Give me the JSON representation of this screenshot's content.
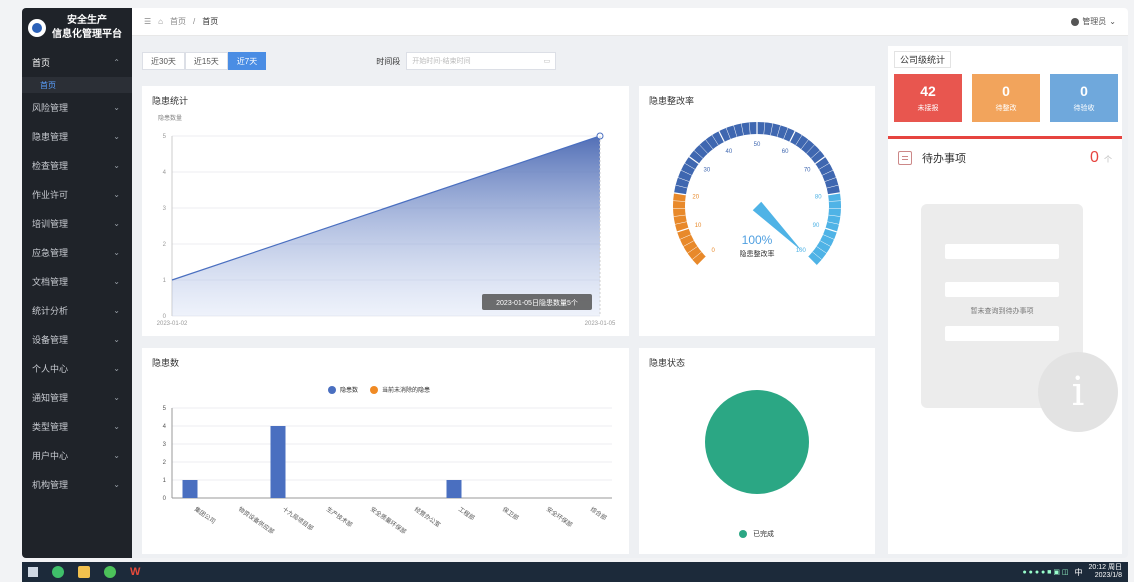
{
  "brand": {
    "line1": "安全生产",
    "line2": "信息化管理平台"
  },
  "sidebar": {
    "items": [
      {
        "label": "首页",
        "open": true
      },
      {
        "label": "风险管理"
      },
      {
        "label": "隐患管理"
      },
      {
        "label": "检查管理"
      },
      {
        "label": "作业许可"
      },
      {
        "label": "培训管理"
      },
      {
        "label": "应急管理"
      },
      {
        "label": "文档管理"
      },
      {
        "label": "统计分析"
      },
      {
        "label": "设备管理"
      },
      {
        "label": "个人中心"
      },
      {
        "label": "通知管理"
      },
      {
        "label": "类型管理"
      },
      {
        "label": "用户中心"
      },
      {
        "label": "机构管理"
      }
    ],
    "sub_item": "首页"
  },
  "topbar": {
    "menu_icon": "☰",
    "home_icon": "home-icon",
    "crumb1": "首页",
    "crumb2": "首页",
    "user": "管理员"
  },
  "toolbar": {
    "ranges": [
      "近30天",
      "近15天",
      "近7天"
    ],
    "active_range": "近7天",
    "date_label": "时间段",
    "date_placeholder": "开始时间-结束时间"
  },
  "panels": {
    "hazard_stats": "隐患统计",
    "rectify_rate": "隐患整改率",
    "hazard_count": "隐患数",
    "hazard_status": "隐患状态",
    "company_stats": "公司级统计"
  },
  "summary": {
    "found": {
      "value": "42",
      "label": "未接报",
      "color": "#e8564f"
    },
    "pending": {
      "value": "0",
      "label": "待整改",
      "color": "#f2a45c"
    },
    "review": {
      "value": "0",
      "label": "待验收",
      "color": "#6fa8dc"
    }
  },
  "todo": {
    "title": "待办事项",
    "count": "0",
    "unit": "个",
    "empty_text": "暂未查询到待办事项"
  },
  "taskbar": {
    "time": "20:12 周日",
    "date": "2023/1/8"
  },
  "chart_data": [
    {
      "type": "area",
      "title": "隐患统计",
      "ylabel": "隐患数量",
      "x": [
        "2023-01-02",
        "2023-01-05"
      ],
      "values": [
        1,
        5
      ],
      "xlim": [
        "2023-01-02",
        "2023-01-05"
      ],
      "ylim": [
        0,
        5
      ],
      "yticks": [
        0,
        1,
        2,
        3,
        4,
        5
      ],
      "grid": true,
      "tooltip": "2023-01-05日隐患数量5个",
      "color": "#4a6fc0"
    },
    {
      "type": "gauge",
      "title": "隐患整改率",
      "value": 100,
      "value_label": "100%",
      "name": "隐患整改率",
      "ticks": [
        0,
        10,
        20,
        30,
        40,
        50,
        60,
        70,
        80,
        90,
        100
      ],
      "colors": {
        "low": "#e8892a",
        "mid": "#3f67b0",
        "high": "#4fb3e6"
      }
    },
    {
      "type": "bar",
      "title": "隐患数",
      "categories": [
        "集团公司",
        "物资设备供应部",
        "十九局项目部",
        "生产技术部",
        "安全质量环保部",
        "经营办公室",
        "工程部",
        "保卫部",
        "安全环保部",
        "综合部"
      ],
      "series": [
        {
          "name": "隐患数",
          "values": [
            1,
            0,
            4,
            0,
            0,
            0,
            1,
            0,
            0,
            0
          ],
          "color": "#4a6fc0"
        },
        {
          "name": "当前未消除的隐患",
          "values": [
            0,
            0,
            0,
            0,
            0,
            0,
            0,
            0,
            0,
            0
          ],
          "color": "#f08a24"
        }
      ],
      "ylim": [
        0,
        5
      ],
      "yticks": [
        0,
        1,
        2,
        3,
        4,
        5
      ],
      "grid": true,
      "legend": "top"
    },
    {
      "type": "pie",
      "title": "隐患状态",
      "slices": [
        {
          "name": "已完成",
          "value": 1,
          "color": "#2ba784"
        }
      ],
      "legend": "bottom"
    }
  ]
}
